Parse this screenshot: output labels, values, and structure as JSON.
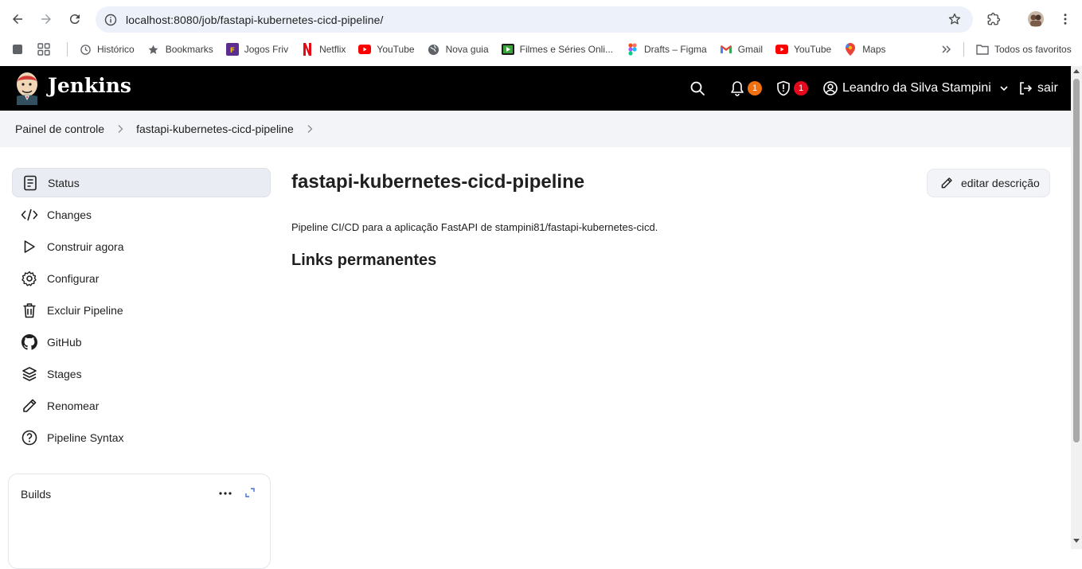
{
  "browser": {
    "url": "localhost:8080/job/fastapi-kubernetes-cicd-pipeline/",
    "bookmarks": [
      {
        "label": "Histórico",
        "icon": "history-icon"
      },
      {
        "label": "Bookmarks",
        "icon": "star-icon"
      },
      {
        "label": "Jogos Friv",
        "icon": "friv-icon"
      },
      {
        "label": "Netflix",
        "icon": "netflix-icon"
      },
      {
        "label": "YouTube",
        "icon": "youtube-icon"
      },
      {
        "label": "Nova guia",
        "icon": "globe-icon"
      },
      {
        "label": "Filmes e Séries Onli...",
        "icon": "film-icon"
      },
      {
        "label": "Drafts – Figma",
        "icon": "figma-icon"
      },
      {
        "label": "Gmail",
        "icon": "gmail-icon"
      },
      {
        "label": "YouTube",
        "icon": "youtube-icon"
      },
      {
        "label": "Maps",
        "icon": "maps-icon"
      }
    ],
    "all_bookmarks_label": "Todos os favoritos"
  },
  "header": {
    "app_title": "Jenkins",
    "notifications_count": "1",
    "security_count": "1",
    "user_name": "Leandro da Silva Stampini",
    "logout_label": "sair",
    "colors": {
      "background": "#000000",
      "notification_badge": "#f0700f",
      "security_badge": "#e5091e"
    }
  },
  "breadcrumb": {
    "items": [
      "Painel de controle",
      "fastapi-kubernetes-cicd-pipeline"
    ]
  },
  "sidebar": {
    "items": [
      {
        "label": "Status",
        "icon": "status-icon",
        "active": true
      },
      {
        "label": "Changes",
        "icon": "code-icon"
      },
      {
        "label": "Construir agora",
        "icon": "play-icon"
      },
      {
        "label": "Configurar",
        "icon": "gear-icon"
      },
      {
        "label": "Excluir Pipeline",
        "icon": "trash-icon"
      },
      {
        "label": "GitHub",
        "icon": "github-icon"
      },
      {
        "label": "Stages",
        "icon": "layers-icon"
      },
      {
        "label": "Renomear",
        "icon": "pencil-icon"
      },
      {
        "label": "Pipeline Syntax",
        "icon": "help-icon"
      }
    ],
    "builds": {
      "title": "Builds"
    }
  },
  "main": {
    "title": "fastapi-kubernetes-cicd-pipeline",
    "edit_description_label": "editar descrição",
    "description": "Pipeline CI/CD para a aplicação FastAPI de stampini81/fastapi-kubernetes-cicd.",
    "permalinks_title": "Links permanentes"
  }
}
